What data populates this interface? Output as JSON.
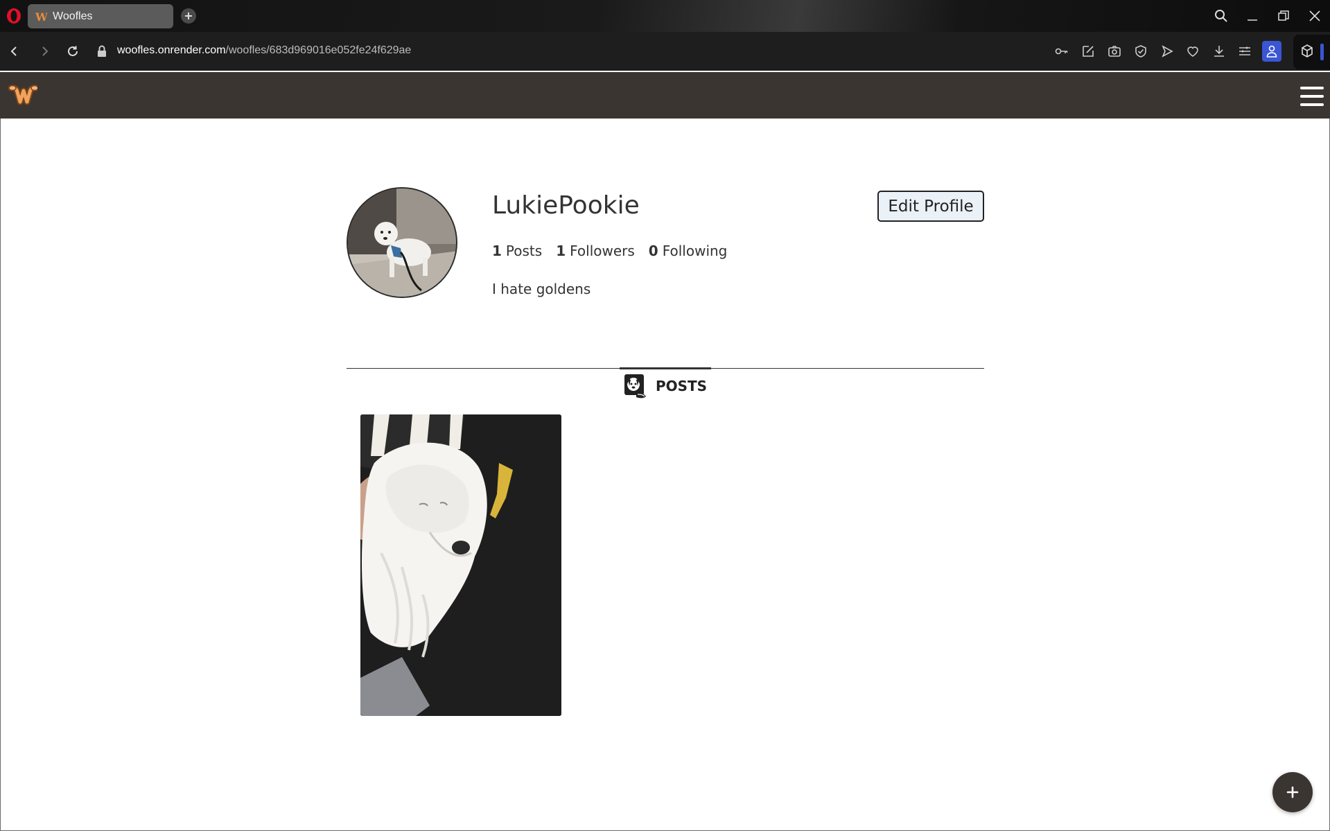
{
  "browser": {
    "tab_title": "Woofles",
    "url_host": "woofles.onrender.com",
    "url_path": "/woofles/683d969016e052fe24f629ae",
    "icons": [
      "opera-logo-icon",
      "new-tab-icon",
      "search-icon",
      "minimize-icon",
      "restore-icon",
      "close-icon",
      "back-icon",
      "forward-icon",
      "reload-icon",
      "lock-icon",
      "key-icon",
      "edit-icon",
      "camera-icon",
      "shield-icon",
      "send-icon",
      "heart-icon",
      "download-icon",
      "menu-lines-icon",
      "profile-icon",
      "cube-icon"
    ],
    "accent_color": "#3a56d4"
  },
  "site": {
    "nav_color": "#3b3532",
    "logo_letter": "W"
  },
  "profile": {
    "username": "LukiePookie",
    "edit_label": "Edit Profile",
    "stats": [
      {
        "count": "1",
        "label": "Posts"
      },
      {
        "count": "1",
        "label": "Followers"
      },
      {
        "count": "0",
        "label": "Following"
      }
    ],
    "bio": "I hate goldens"
  },
  "posts_tab": {
    "label": "POSTS"
  },
  "posts": [
    {
      "alt": "white fluffy dog sleeping on lap"
    }
  ]
}
